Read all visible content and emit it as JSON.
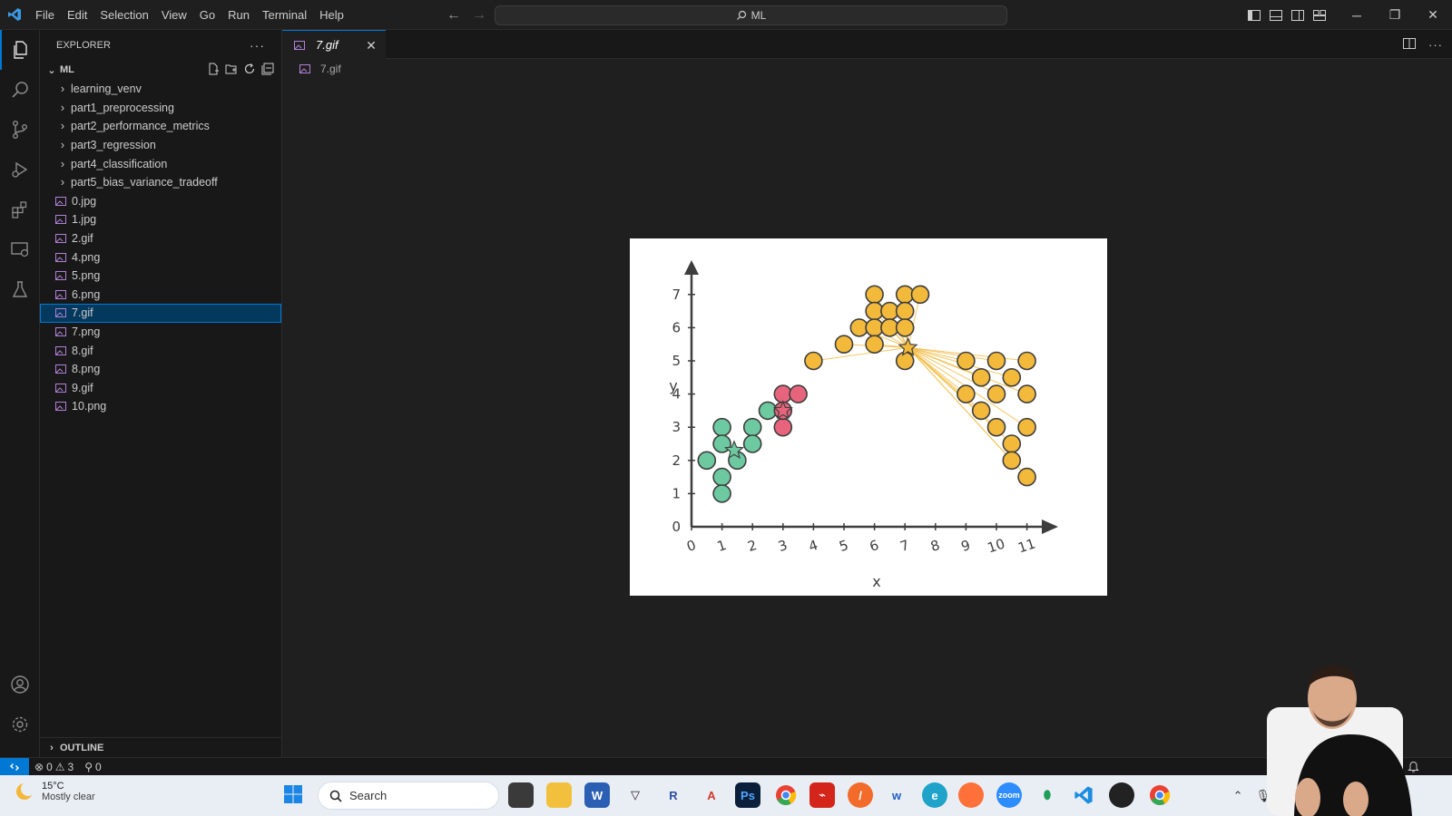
{
  "titlebar": {
    "menus": [
      "File",
      "Edit",
      "Selection",
      "View",
      "Go",
      "Run",
      "Terminal",
      "Help"
    ],
    "search_text": "ML"
  },
  "sidebar": {
    "title": "EXPLORER",
    "folder": "ML",
    "dirs": [
      "learning_venv",
      "part1_preprocessing",
      "part2_performance_metrics",
      "part3_regression",
      "part4_classification",
      "part5_bias_variance_tradeoff"
    ],
    "files": [
      "0.jpg",
      "1.jpg",
      "2.gif",
      "4.png",
      "5.png",
      "6.png",
      "7.gif",
      "7.png",
      "8.gif",
      "8.png",
      "9.gif",
      "10.png"
    ],
    "selected_file": "7.gif",
    "outline_label": "OUTLINE"
  },
  "editor": {
    "tab_label": "7.gif",
    "breadcrumb": "7.gif"
  },
  "statusbar": {
    "errors": "0",
    "warnings": "3",
    "ports": "0"
  },
  "taskbar": {
    "temperature": "15°C",
    "weather": "Mostly clear",
    "search_placeholder": "Search"
  },
  "chart_data": {
    "type": "scatter",
    "xlabel": "x",
    "ylabel": "y",
    "xlim": [
      0,
      11
    ],
    "ylim": [
      0,
      7
    ],
    "x_ticks": [
      "0",
      "1",
      "2",
      "3",
      "4",
      "5",
      "6",
      "7",
      "8",
      "9",
      "10",
      "11"
    ],
    "y_ticks": [
      "0",
      "1",
      "2",
      "3",
      "4",
      "5",
      "6",
      "7"
    ],
    "colors": {
      "green": "#6cc9a0",
      "red": "#e8647c",
      "orange": "#f2b93b"
    },
    "series": [
      {
        "color": "green",
        "points": [
          [
            0.5,
            2
          ],
          [
            1,
            3
          ],
          [
            1,
            2.5
          ],
          [
            1,
            1.5
          ],
          [
            1,
            1
          ],
          [
            1.5,
            2
          ],
          [
            2,
            3
          ],
          [
            2,
            2.5
          ],
          [
            2.5,
            3.5
          ]
        ],
        "centroid": [
          1.4,
          2.3
        ]
      },
      {
        "color": "red",
        "points": [
          [
            3,
            4
          ],
          [
            3.5,
            4
          ],
          [
            3,
            3
          ],
          [
            3,
            3.5
          ]
        ],
        "centroid": [
          3,
          3.5
        ]
      },
      {
        "color": "orange",
        "points": [
          [
            4,
            5
          ],
          [
            5,
            5.5
          ],
          [
            5.5,
            6
          ],
          [
            6,
            7
          ],
          [
            6,
            6.5
          ],
          [
            6,
            6
          ],
          [
            6,
            5.5
          ],
          [
            6.5,
            6.5
          ],
          [
            6.5,
            6
          ],
          [
            7,
            7
          ],
          [
            7,
            6.5
          ],
          [
            7,
            6
          ],
          [
            7.5,
            7
          ],
          [
            7,
            5
          ],
          [
            9,
            5
          ],
          [
            9.5,
            4.5
          ],
          [
            9,
            4
          ],
          [
            9.5,
            3.5
          ],
          [
            10,
            5
          ],
          [
            10,
            4
          ],
          [
            10,
            3
          ],
          [
            10.5,
            4.5
          ],
          [
            10.5,
            2.5
          ],
          [
            10.5,
            2
          ],
          [
            11,
            5
          ],
          [
            11,
            4
          ],
          [
            11,
            3
          ],
          [
            11,
            1.5
          ]
        ],
        "centroid": [
          7.1,
          5.4
        ]
      }
    ]
  }
}
